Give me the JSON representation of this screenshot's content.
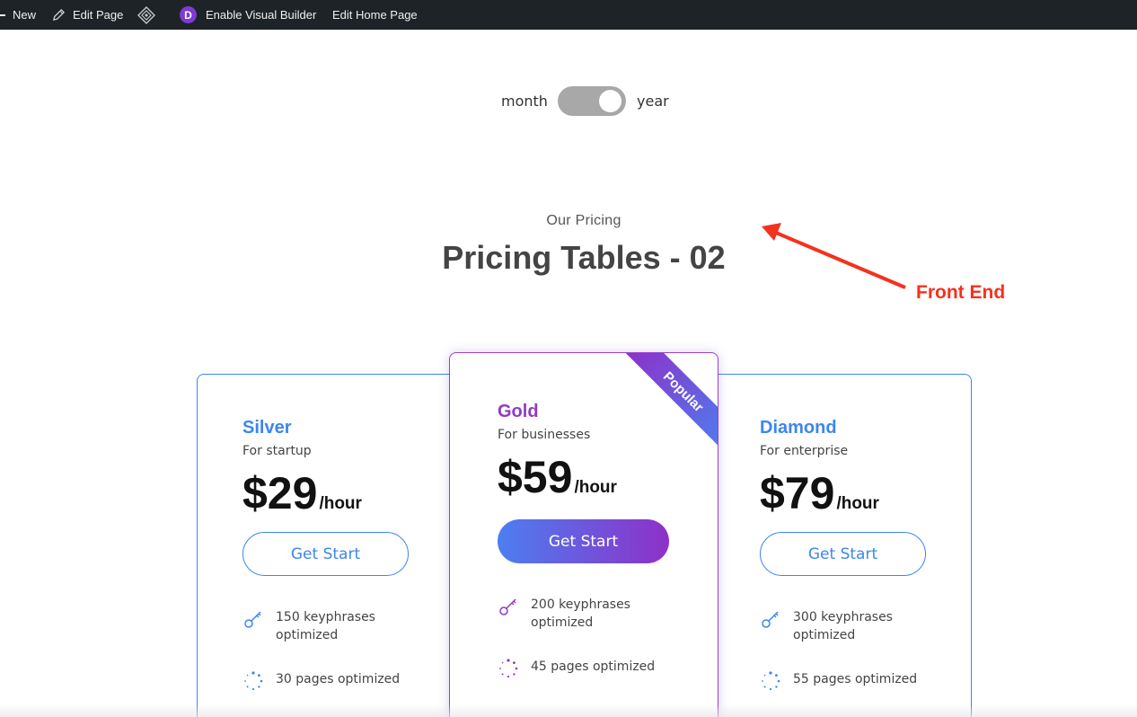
{
  "admin_bar": {
    "new_label": "New",
    "edit_page_label": "Edit Page",
    "divi_letter": "D",
    "visual_builder_label": "Enable Visual Builder",
    "edit_home_label": "Edit Home Page"
  },
  "billing_toggle": {
    "left_label": "month",
    "right_label": "year",
    "state": "year"
  },
  "section": {
    "eyebrow": "Our Pricing",
    "title": "Pricing Tables - 02"
  },
  "annotation": {
    "text": "Front End",
    "color": "#f4311e"
  },
  "plans": [
    {
      "name": "Silver",
      "subtitle": "For startup",
      "price": "$29",
      "period": "/hour",
      "button": "Get Start",
      "features": [
        "150 keyphrases optimized",
        "30 pages optimized"
      ],
      "accent": "#3b86f0"
    },
    {
      "name": "Gold",
      "subtitle": "For businesses",
      "price": "$59",
      "period": "/hour",
      "button": "Get Start",
      "badge": "Popular",
      "features": [
        "200 keyphrases optimized",
        "45 pages optimized"
      ],
      "accent": "#8e3bc7"
    },
    {
      "name": "Diamond",
      "subtitle": "For enterprise",
      "price": "$79",
      "period": "/hour",
      "button": "Get Start",
      "features": [
        "300 keyphrases optimized",
        "55 pages optimized"
      ],
      "accent": "#3b86f0"
    }
  ],
  "icons": {
    "edit": "pencil-icon",
    "divi_layout": "diamond-icon",
    "keyphrases": "key-icon",
    "pages": "loader-icon"
  }
}
